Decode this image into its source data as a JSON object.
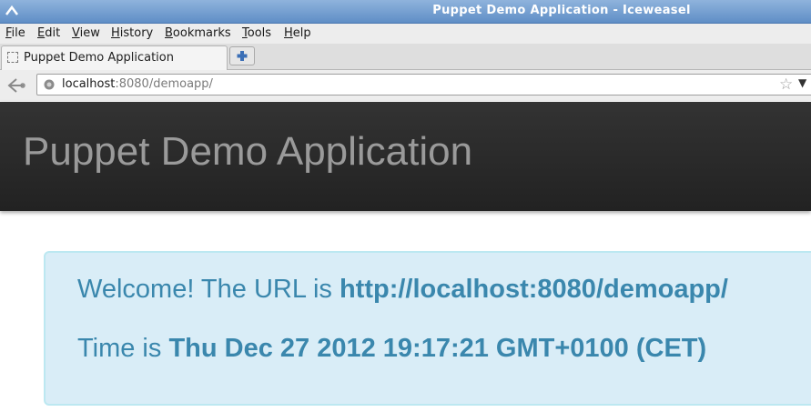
{
  "window": {
    "title": "Puppet Demo Application - Iceweasel"
  },
  "menu": [
    "File",
    "Edit",
    "View",
    "History",
    "Bookmarks",
    "Tools",
    "Help"
  ],
  "tab": {
    "label": "Puppet Demo Application"
  },
  "address_bar": {
    "host": "localhost",
    "rest": ":8080/demoapp/"
  },
  "page": {
    "brand": "Puppet Demo Application",
    "welcome_prefix": "Welcome! The URL is ",
    "welcome_url": "http://localhost:8080/demoapp/",
    "time_prefix": "Time is ",
    "time_value": "Thu Dec 27 2012 19:17:21 GMT+0100 (CET)"
  },
  "colors": {
    "alert_text": "#3a87ad",
    "alert_bg": "#d9edf7",
    "header_bg": "#2a2a2a"
  },
  "icons": [
    "window-icon",
    "tab-favicon",
    "new-tab-icon",
    "back-icon",
    "site-globe-icon",
    "bookmark-star-icon",
    "url-dropdown-icon"
  ]
}
